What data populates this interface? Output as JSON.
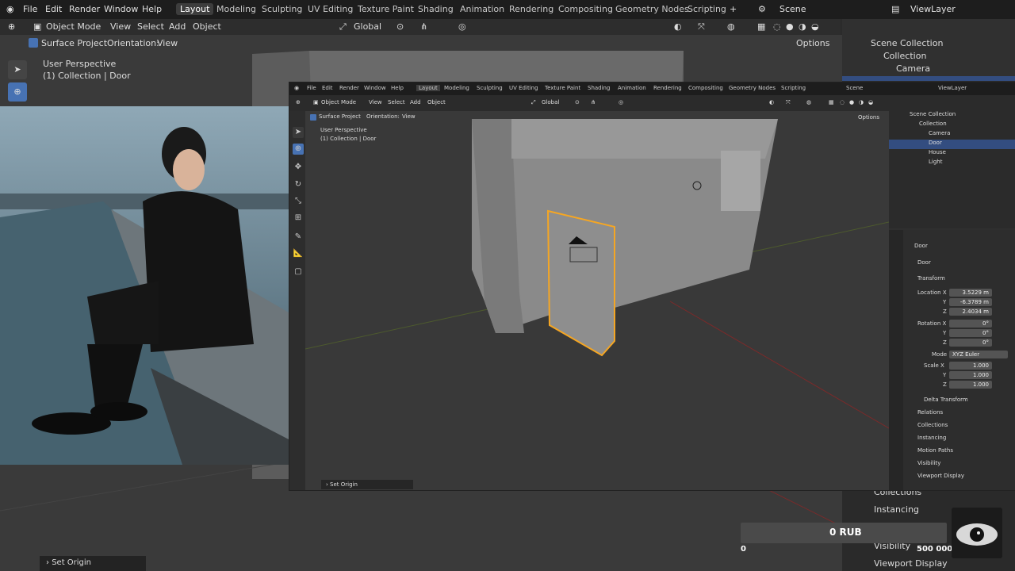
{
  "top_menu": {
    "items": [
      "File",
      "Edit",
      "Render",
      "Window",
      "Help"
    ],
    "workspaces": [
      "Layout",
      "Modeling",
      "Sculpting",
      "UV Editing",
      "Texture Paint",
      "Shading",
      "Animation",
      "Rendering",
      "Compositing",
      "Geometry Nodes",
      "Scripting"
    ],
    "scene": "Scene",
    "view_layer": "ViewLayer"
  },
  "viewport_header": {
    "mode": "Object Mode",
    "menus": [
      "View",
      "Select",
      "Add",
      "Object"
    ],
    "orientation": "Global",
    "options": "Options"
  },
  "tool_settings": {
    "surface_project": "Surface Project",
    "orientation_label": "Orientation:",
    "orientation_value": "View"
  },
  "viewport_info": {
    "perspective": "User Perspective",
    "collection": "(1) Collection | Door"
  },
  "outliner": {
    "scene_collection": "Scene Collection",
    "items": [
      "Collection",
      "Camera",
      "Door",
      "House",
      "Light"
    ]
  },
  "properties": {
    "object_name": "Door",
    "data_name": "Door",
    "section_transform": "Transform",
    "location_label": "Location X",
    "location": [
      "3.5229 m",
      "-6.3789 m",
      "2.4034 m"
    ],
    "rotation_label": "Rotation X",
    "rotation": [
      "0°",
      "0°",
      "0°"
    ],
    "mode_label": "Mode",
    "mode_value": "XYZ Euler",
    "scale_label": "Scale X",
    "scale": [
      "1.000",
      "1.000",
      "1.000"
    ],
    "axis_y": "Y",
    "axis_z": "Z",
    "panels": [
      "Delta Transform",
      "Relations",
      "Collections",
      "Instancing",
      "Motion Paths",
      "Visibility",
      "Viewport Display"
    ]
  },
  "bottom_right_panels": [
    "Collections",
    "Instancing",
    "Visibility",
    "Viewport Display"
  ],
  "last_op": "Set Origin",
  "donation": {
    "amount": "0 RUB",
    "min": "0",
    "max": "500 000"
  },
  "colors": {
    "accent_blue": "#4772b3",
    "selection_orange": "#f5a623",
    "header_bg": "#1d1d1d"
  }
}
